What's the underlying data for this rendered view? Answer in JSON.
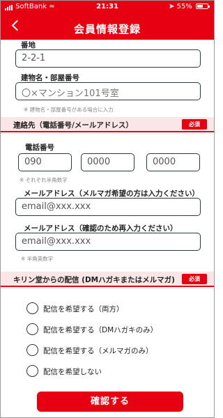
{
  "status_bar": {
    "carrier": "SoftBank",
    "time": "21:31",
    "battery": "55%"
  },
  "header": {
    "title": "会員情報登録"
  },
  "address": {
    "banchi_label": "番地",
    "banchi_value": "2-2-1",
    "building_label": "建物名・部屋番号",
    "building_placeholder": "〇×マンション101号室",
    "building_note": "※ 建物名・部屋番号がある場合に入力"
  },
  "contact_section": {
    "title": "連絡先（電話番号/メールアドレス）",
    "required_badge": "必須",
    "phone_label": "電話番号",
    "phone_parts": [
      "090",
      "0000",
      "0000"
    ],
    "phone_note": "※ それぞれ半角数字",
    "email_label": "メールアドレス（メルマガ希望の方は入力ください）",
    "email_placeholder": "email@xxx.xxx",
    "email_confirm_label": "メールアドレス（確認のため再入力ください）",
    "email_confirm_placeholder": "email@xxx.xxx",
    "email_note": "※ 半角英数字"
  },
  "delivery_section": {
    "title": "キリン堂からの配信 (DMハガキまたはメルマガ)",
    "required_badge": "必須",
    "options": [
      "配信を希望する（両方）",
      "配信を希望する（DMハガキのみ）",
      "配信を希望する（メルマガのみ）",
      "配信を希望しない"
    ]
  },
  "confirm_button": "確認する",
  "colors": {
    "brand_red": "#e60012",
    "section_bg": "#fbe6e7",
    "field_border": "#2b3a3d"
  }
}
